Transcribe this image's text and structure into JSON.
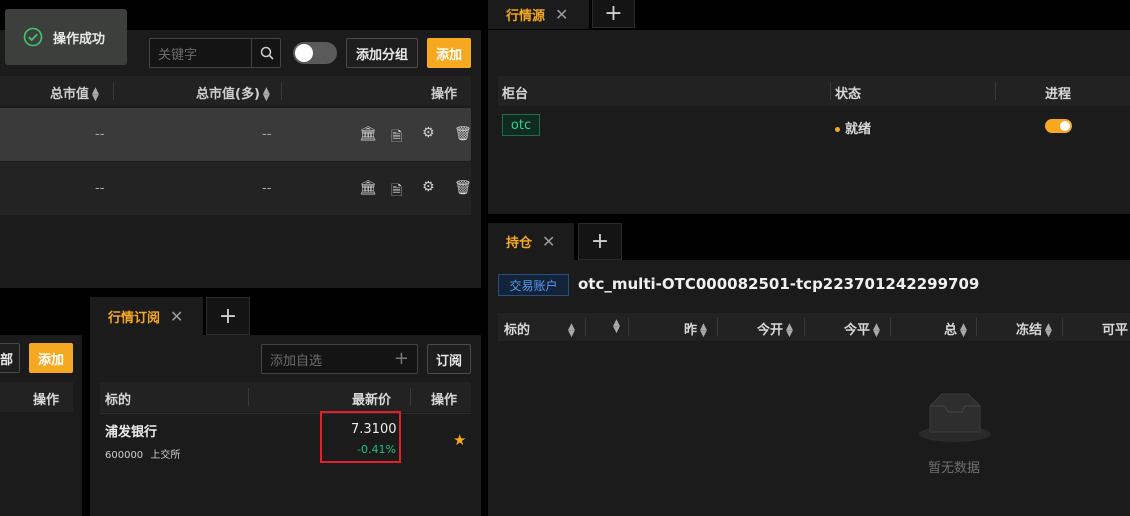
{
  "toast": {
    "text": "操作成功"
  },
  "top_left": {
    "search_placeholder": "关键字",
    "add_group_label": "添加分组",
    "add_label": "添加",
    "headers": {
      "total_value": "总市值",
      "total_value_long": "总市值(多)",
      "action": "操作"
    },
    "rows": [
      {
        "total_value": "--",
        "total_value_long": "--"
      },
      {
        "total_value": "--",
        "total_value_long": "--"
      }
    ]
  },
  "market_source": {
    "tab_label": "行情源",
    "headers": {
      "counter": "柜台",
      "status": "状态",
      "process": "进程"
    },
    "rows": [
      {
        "counter": "otc",
        "status": "就绪",
        "process_on": true
      }
    ],
    "colors": {
      "ready_dot": "#f6a821",
      "toggle_on": "#f6a821"
    }
  },
  "positions": {
    "tab_label": "持仓",
    "account_badge": "交易账户",
    "account_name": "otc_multi-OTC000082501-tcp223701242299709",
    "headers": {
      "symbol": "标的",
      "yesterday": "昨",
      "open_today": "今开",
      "close_today": "今平",
      "total": "总",
      "frozen": "冻结",
      "available": "可平"
    },
    "empty_text": "暂无数据"
  },
  "bottom_left": {
    "partial_label": "部",
    "add_label": "添加",
    "action_header": "操作"
  },
  "subscription": {
    "tab_label": "行情订阅",
    "add_placeholder": "添加自选",
    "subscribe_label": "订阅",
    "headers": {
      "symbol": "标的",
      "latest_price": "最新价",
      "action": "操作"
    },
    "rows": [
      {
        "name": "浦发银行",
        "code": "600000",
        "exchange": "上交所",
        "price": "7.3100",
        "change": "-0.41%"
      }
    ],
    "colors": {
      "change": "#19c37d",
      "highlight_box": "#e0202a",
      "star": "#f6a821"
    }
  }
}
